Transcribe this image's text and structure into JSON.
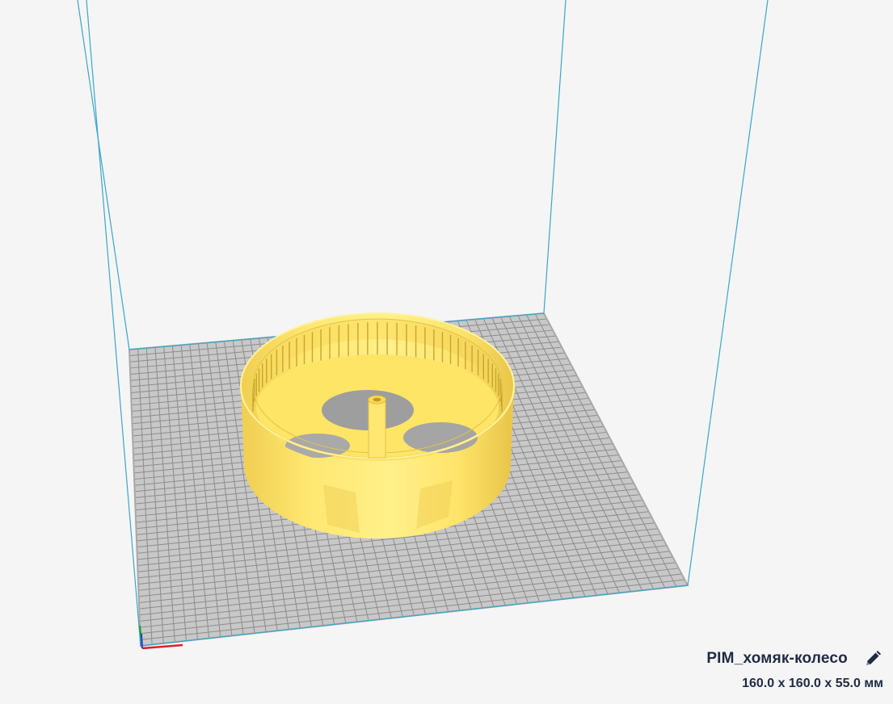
{
  "object": {
    "name": "PIM_хомяк-колесо",
    "dimensions": "160.0 x 160.0 x 55.0 мм",
    "edit_icon": "pencil-icon"
  },
  "scene": {
    "background_color": "#f5f5f5",
    "build_volume_line_color": "#3aa6c8",
    "build_plate_color": "#c8c8c8",
    "build_plate_grid_color": "#8c8c8c",
    "model_color": "#ffe36b",
    "model_shadow_color": "#e9c740",
    "axis_colors": {
      "x": "#e02020",
      "y": "#20a020",
      "z": "#2040e0"
    }
  }
}
